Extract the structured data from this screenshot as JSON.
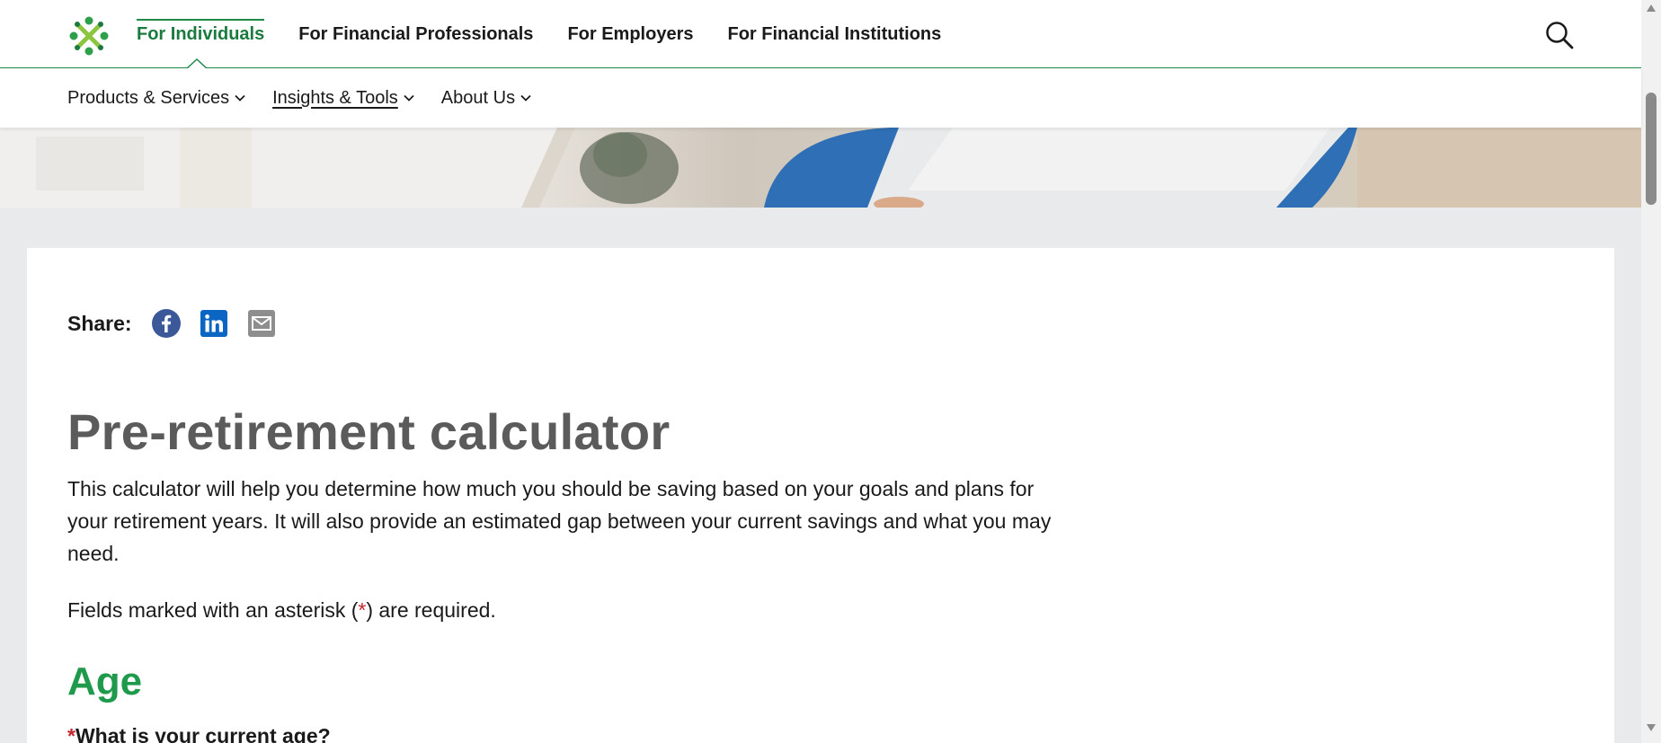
{
  "top_nav": {
    "items": [
      {
        "label": "For Individuals",
        "active": true
      },
      {
        "label": "For Financial Professionals",
        "active": false
      },
      {
        "label": "For Employers",
        "active": false
      },
      {
        "label": "For Financial Institutions",
        "active": false
      }
    ],
    "search_icon": "search-icon",
    "logo_icon": "lincoln-logo"
  },
  "sub_nav": {
    "items": [
      {
        "label": "Products & Services"
      },
      {
        "label": "Insights & Tools"
      },
      {
        "label": "About Us"
      }
    ]
  },
  "share": {
    "label": "Share:",
    "icons": [
      "facebook-icon",
      "linkedin-icon",
      "email-icon"
    ]
  },
  "main": {
    "title": "Pre-retirement calculator",
    "intro": "This calculator will help you determine how much you should be saving based on your goals and plans for your retirement years. It will also provide an estimated gap between your current savings and what you may need.",
    "fields_note_before": "Fields marked with an asterisk (",
    "fields_note_asterisk": "*",
    "fields_note_after": ") are required.",
    "section_title": "Age",
    "question_asterisk": "*",
    "question": "What is your current age?"
  },
  "colors": {
    "brand_green": "#1f9a4c",
    "title_gray": "#5b5b5b",
    "required_red": "#c4262e",
    "facebook_blue": "#3b5998",
    "linkedin_blue": "#0a66c2"
  }
}
